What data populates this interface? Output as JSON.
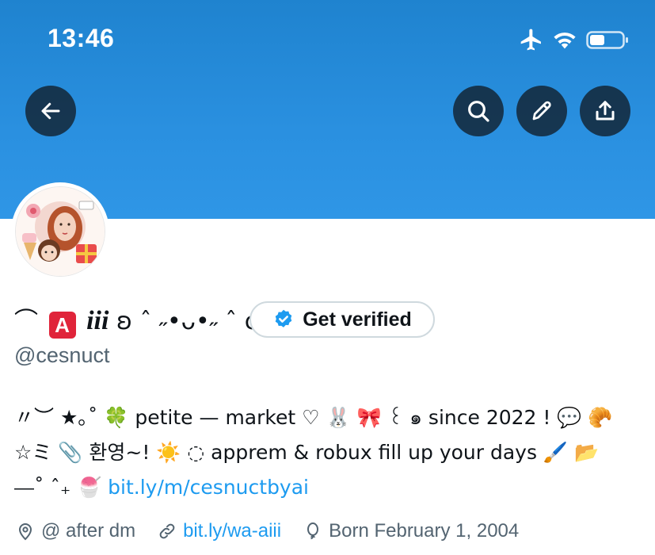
{
  "status_bar": {
    "time": "13:46",
    "icons": [
      "airplane-icon",
      "wifi-icon",
      "battery-icon"
    ]
  },
  "header": {
    "buttons": [
      "back-button",
      "search-button",
      "edit-button",
      "share-button"
    ]
  },
  "profile": {
    "display_name_prefix": "⌒",
    "display_name_badge": "A",
    "display_name_main": "iii",
    "display_name_suffix": "ʚ ˆ ˶•ᴗ•˶ ˆ ɞ",
    "get_verified_label": "Get verified",
    "handle": "@cesnuct",
    "bio": {
      "line1": "〃︶ ★｡˚ 🍀 petite — market ♡ 🐰 🎀 ꒰ ๑ since 2022 ! 💬 🥐",
      "line2": "☆ミ 📎 환영~! ☀️ ◌ apprem & robux fill up your days 🖌️ 📂",
      "line3_prefix": "⎯⎯˚ ˆ₊ 🍧 ",
      "line3_link": "bit.ly/m/cesnuctbyai"
    },
    "meta": {
      "location": "@ after dm",
      "website": "bit.ly/wa-aiii",
      "birthday": "Born February 1, 2004"
    }
  },
  "colors": {
    "banner": "#2a90e0",
    "link": "#1d9bf0",
    "verified": "#1d9bf0",
    "secondary_text": "#536471"
  }
}
